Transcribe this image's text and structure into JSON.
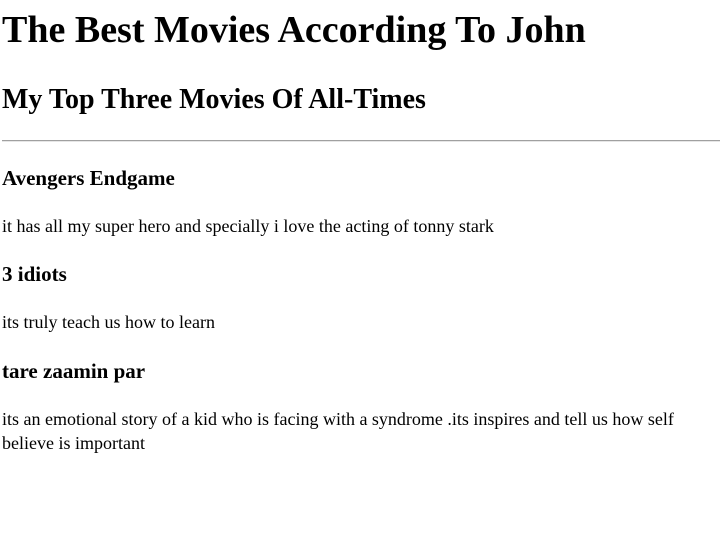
{
  "page": {
    "title": "The Best Movies According To John",
    "subtitle": "My Top Three Movies Of All-Times"
  },
  "movies": [
    {
      "title": "Avengers Endgame",
      "description": "it has all my super hero and specially i love the acting of tonny stark"
    },
    {
      "title": "3 idiots",
      "description": "its truly teach us how to learn"
    },
    {
      "title": "tare zaamin par",
      "description": "its an emotional story of a kid who is facing with a syndrome .its inspires and tell us how self believe is important"
    }
  ]
}
